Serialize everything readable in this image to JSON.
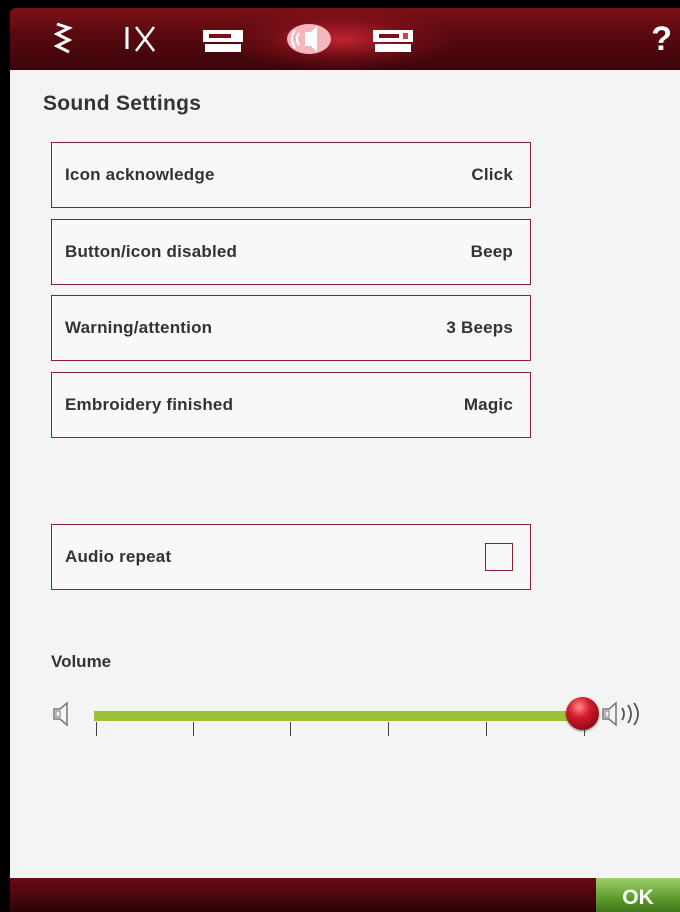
{
  "toolbar": {
    "icons": [
      "stitch-zigzag-icon",
      "needle-thread-icon",
      "sewing-machine-icon",
      "sound-icon",
      "embroidery-machine-icon",
      "help-icon"
    ],
    "help_label": "?"
  },
  "page": {
    "title": "Sound Settings"
  },
  "settings": [
    {
      "label": "Icon acknowledge",
      "value": "Click"
    },
    {
      "label": "Button/icon disabled",
      "value": "Beep"
    },
    {
      "label": "Warning/attention",
      "value": "3 Beeps"
    },
    {
      "label": "Embroidery finished",
      "value": "Magic"
    }
  ],
  "audio_repeat": {
    "label": "Audio repeat",
    "checked": false
  },
  "volume": {
    "label": "Volume",
    "level": 1.0,
    "ticks": 6
  },
  "footer": {
    "ok_label": "OK"
  },
  "colors": {
    "accent": "#8a2230",
    "slider": "#9dc239",
    "ok": "#5e9b2e"
  }
}
